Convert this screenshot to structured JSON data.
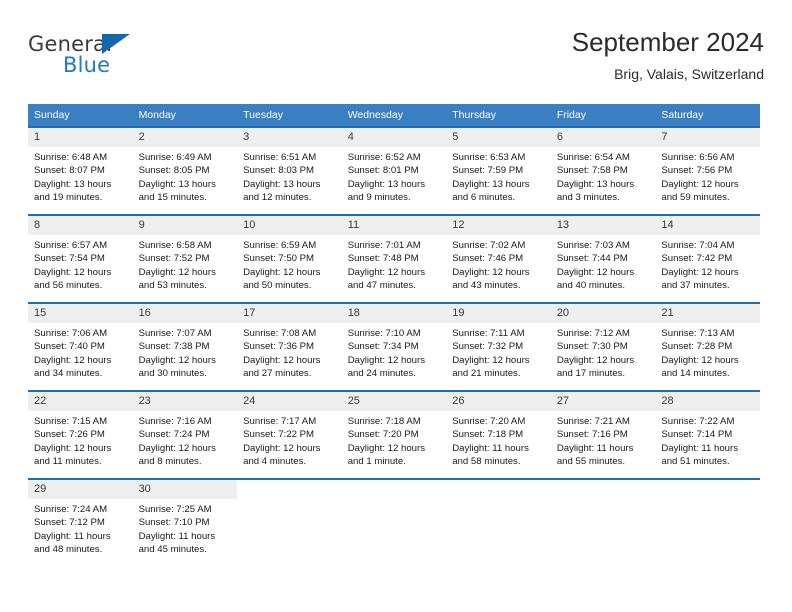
{
  "brand": {
    "word_one": "General",
    "word_two": "Blue",
    "flag_icon": "triangle-flag-icon",
    "blue_hex": "#1f7ac0"
  },
  "header": {
    "title": "September 2024",
    "location": "Brig, Valais, Switzerland"
  },
  "theme": {
    "header_bg": "#3a7fc1",
    "row_rule": "#1f6eb5",
    "daynum_bg": "#efefef"
  },
  "calendar": {
    "weekday_headers": [
      "Sunday",
      "Monday",
      "Tuesday",
      "Wednesday",
      "Thursday",
      "Friday",
      "Saturday"
    ],
    "weeks": [
      [
        {
          "day": "1",
          "sunrise": "Sunrise: 6:48 AM",
          "sunset": "Sunset: 8:07 PM",
          "daylight_line1": "Daylight: 13 hours",
          "daylight_line2": "and 19 minutes."
        },
        {
          "day": "2",
          "sunrise": "Sunrise: 6:49 AM",
          "sunset": "Sunset: 8:05 PM",
          "daylight_line1": "Daylight: 13 hours",
          "daylight_line2": "and 15 minutes."
        },
        {
          "day": "3",
          "sunrise": "Sunrise: 6:51 AM",
          "sunset": "Sunset: 8:03 PM",
          "daylight_line1": "Daylight: 13 hours",
          "daylight_line2": "and 12 minutes."
        },
        {
          "day": "4",
          "sunrise": "Sunrise: 6:52 AM",
          "sunset": "Sunset: 8:01 PM",
          "daylight_line1": "Daylight: 13 hours",
          "daylight_line2": "and 9 minutes."
        },
        {
          "day": "5",
          "sunrise": "Sunrise: 6:53 AM",
          "sunset": "Sunset: 7:59 PM",
          "daylight_line1": "Daylight: 13 hours",
          "daylight_line2": "and 6 minutes."
        },
        {
          "day": "6",
          "sunrise": "Sunrise: 6:54 AM",
          "sunset": "Sunset: 7:58 PM",
          "daylight_line1": "Daylight: 13 hours",
          "daylight_line2": "and 3 minutes."
        },
        {
          "day": "7",
          "sunrise": "Sunrise: 6:56 AM",
          "sunset": "Sunset: 7:56 PM",
          "daylight_line1": "Daylight: 12 hours",
          "daylight_line2": "and 59 minutes."
        }
      ],
      [
        {
          "day": "8",
          "sunrise": "Sunrise: 6:57 AM",
          "sunset": "Sunset: 7:54 PM",
          "daylight_line1": "Daylight: 12 hours",
          "daylight_line2": "and 56 minutes."
        },
        {
          "day": "9",
          "sunrise": "Sunrise: 6:58 AM",
          "sunset": "Sunset: 7:52 PM",
          "daylight_line1": "Daylight: 12 hours",
          "daylight_line2": "and 53 minutes."
        },
        {
          "day": "10",
          "sunrise": "Sunrise: 6:59 AM",
          "sunset": "Sunset: 7:50 PM",
          "daylight_line1": "Daylight: 12 hours",
          "daylight_line2": "and 50 minutes."
        },
        {
          "day": "11",
          "sunrise": "Sunrise: 7:01 AM",
          "sunset": "Sunset: 7:48 PM",
          "daylight_line1": "Daylight: 12 hours",
          "daylight_line2": "and 47 minutes."
        },
        {
          "day": "12",
          "sunrise": "Sunrise: 7:02 AM",
          "sunset": "Sunset: 7:46 PM",
          "daylight_line1": "Daylight: 12 hours",
          "daylight_line2": "and 43 minutes."
        },
        {
          "day": "13",
          "sunrise": "Sunrise: 7:03 AM",
          "sunset": "Sunset: 7:44 PM",
          "daylight_line1": "Daylight: 12 hours",
          "daylight_line2": "and 40 minutes."
        },
        {
          "day": "14",
          "sunrise": "Sunrise: 7:04 AM",
          "sunset": "Sunset: 7:42 PM",
          "daylight_line1": "Daylight: 12 hours",
          "daylight_line2": "and 37 minutes."
        }
      ],
      [
        {
          "day": "15",
          "sunrise": "Sunrise: 7:06 AM",
          "sunset": "Sunset: 7:40 PM",
          "daylight_line1": "Daylight: 12 hours",
          "daylight_line2": "and 34 minutes."
        },
        {
          "day": "16",
          "sunrise": "Sunrise: 7:07 AM",
          "sunset": "Sunset: 7:38 PM",
          "daylight_line1": "Daylight: 12 hours",
          "daylight_line2": "and 30 minutes."
        },
        {
          "day": "17",
          "sunrise": "Sunrise: 7:08 AM",
          "sunset": "Sunset: 7:36 PM",
          "daylight_line1": "Daylight: 12 hours",
          "daylight_line2": "and 27 minutes."
        },
        {
          "day": "18",
          "sunrise": "Sunrise: 7:10 AM",
          "sunset": "Sunset: 7:34 PM",
          "daylight_line1": "Daylight: 12 hours",
          "daylight_line2": "and 24 minutes."
        },
        {
          "day": "19",
          "sunrise": "Sunrise: 7:11 AM",
          "sunset": "Sunset: 7:32 PM",
          "daylight_line1": "Daylight: 12 hours",
          "daylight_line2": "and 21 minutes."
        },
        {
          "day": "20",
          "sunrise": "Sunrise: 7:12 AM",
          "sunset": "Sunset: 7:30 PM",
          "daylight_line1": "Daylight: 12 hours",
          "daylight_line2": "and 17 minutes."
        },
        {
          "day": "21",
          "sunrise": "Sunrise: 7:13 AM",
          "sunset": "Sunset: 7:28 PM",
          "daylight_line1": "Daylight: 12 hours",
          "daylight_line2": "and 14 minutes."
        }
      ],
      [
        {
          "day": "22",
          "sunrise": "Sunrise: 7:15 AM",
          "sunset": "Sunset: 7:26 PM",
          "daylight_line1": "Daylight: 12 hours",
          "daylight_line2": "and 11 minutes."
        },
        {
          "day": "23",
          "sunrise": "Sunrise: 7:16 AM",
          "sunset": "Sunset: 7:24 PM",
          "daylight_line1": "Daylight: 12 hours",
          "daylight_line2": "and 8 minutes."
        },
        {
          "day": "24",
          "sunrise": "Sunrise: 7:17 AM",
          "sunset": "Sunset: 7:22 PM",
          "daylight_line1": "Daylight: 12 hours",
          "daylight_line2": "and 4 minutes."
        },
        {
          "day": "25",
          "sunrise": "Sunrise: 7:18 AM",
          "sunset": "Sunset: 7:20 PM",
          "daylight_line1": "Daylight: 12 hours",
          "daylight_line2": "and 1 minute."
        },
        {
          "day": "26",
          "sunrise": "Sunrise: 7:20 AM",
          "sunset": "Sunset: 7:18 PM",
          "daylight_line1": "Daylight: 11 hours",
          "daylight_line2": "and 58 minutes."
        },
        {
          "day": "27",
          "sunrise": "Sunrise: 7:21 AM",
          "sunset": "Sunset: 7:16 PM",
          "daylight_line1": "Daylight: 11 hours",
          "daylight_line2": "and 55 minutes."
        },
        {
          "day": "28",
          "sunrise": "Sunrise: 7:22 AM",
          "sunset": "Sunset: 7:14 PM",
          "daylight_line1": "Daylight: 11 hours",
          "daylight_line2": "and 51 minutes."
        }
      ],
      [
        {
          "day": "29",
          "sunrise": "Sunrise: 7:24 AM",
          "sunset": "Sunset: 7:12 PM",
          "daylight_line1": "Daylight: 11 hours",
          "daylight_line2": "and 48 minutes."
        },
        {
          "day": "30",
          "sunrise": "Sunrise: 7:25 AM",
          "sunset": "Sunset: 7:10 PM",
          "daylight_line1": "Daylight: 11 hours",
          "daylight_line2": "and 45 minutes."
        },
        {
          "day": "",
          "sunrise": "",
          "sunset": "",
          "daylight_line1": "",
          "daylight_line2": ""
        },
        {
          "day": "",
          "sunrise": "",
          "sunset": "",
          "daylight_line1": "",
          "daylight_line2": ""
        },
        {
          "day": "",
          "sunrise": "",
          "sunset": "",
          "daylight_line1": "",
          "daylight_line2": ""
        },
        {
          "day": "",
          "sunrise": "",
          "sunset": "",
          "daylight_line1": "",
          "daylight_line2": ""
        },
        {
          "day": "",
          "sunrise": "",
          "sunset": "",
          "daylight_line1": "",
          "daylight_line2": ""
        }
      ]
    ]
  }
}
